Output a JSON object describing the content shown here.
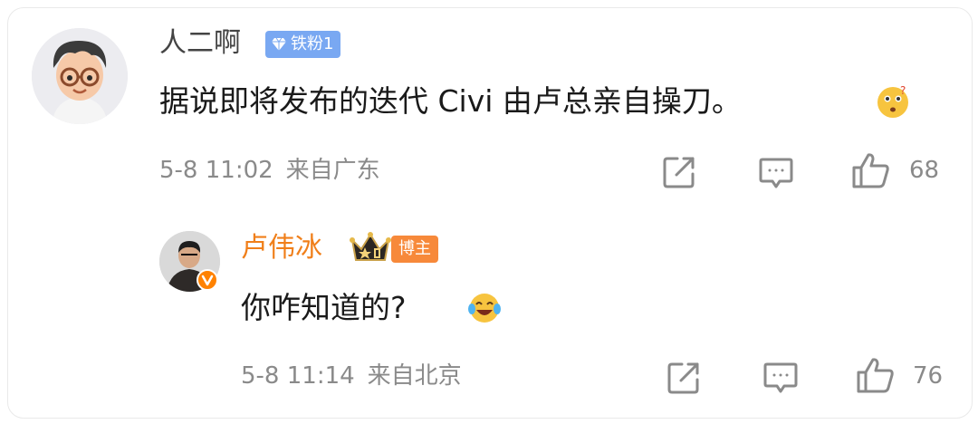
{
  "comment": {
    "username": "人二啊",
    "fan_badge": "铁粉1",
    "text": "据说即将发布的迭代 Civi 由卢总亲自操刀。",
    "time": "5-8 11:02",
    "location": "来自广东",
    "like_count": "68",
    "emoji_icon": "thinking-face-emoji",
    "reply": {
      "username": "卢伟冰",
      "blogger_badge": "博主",
      "text": "你咋知道的?",
      "time": "5-8 11:14",
      "location": "来自北京",
      "like_count": "76",
      "emoji_icon": "laughing-tears-emoji"
    }
  },
  "colors": {
    "accent_orange": "#f07f1a",
    "fan_badge_blue": "#79a8f2",
    "meta_gray": "#8a8a8a"
  }
}
